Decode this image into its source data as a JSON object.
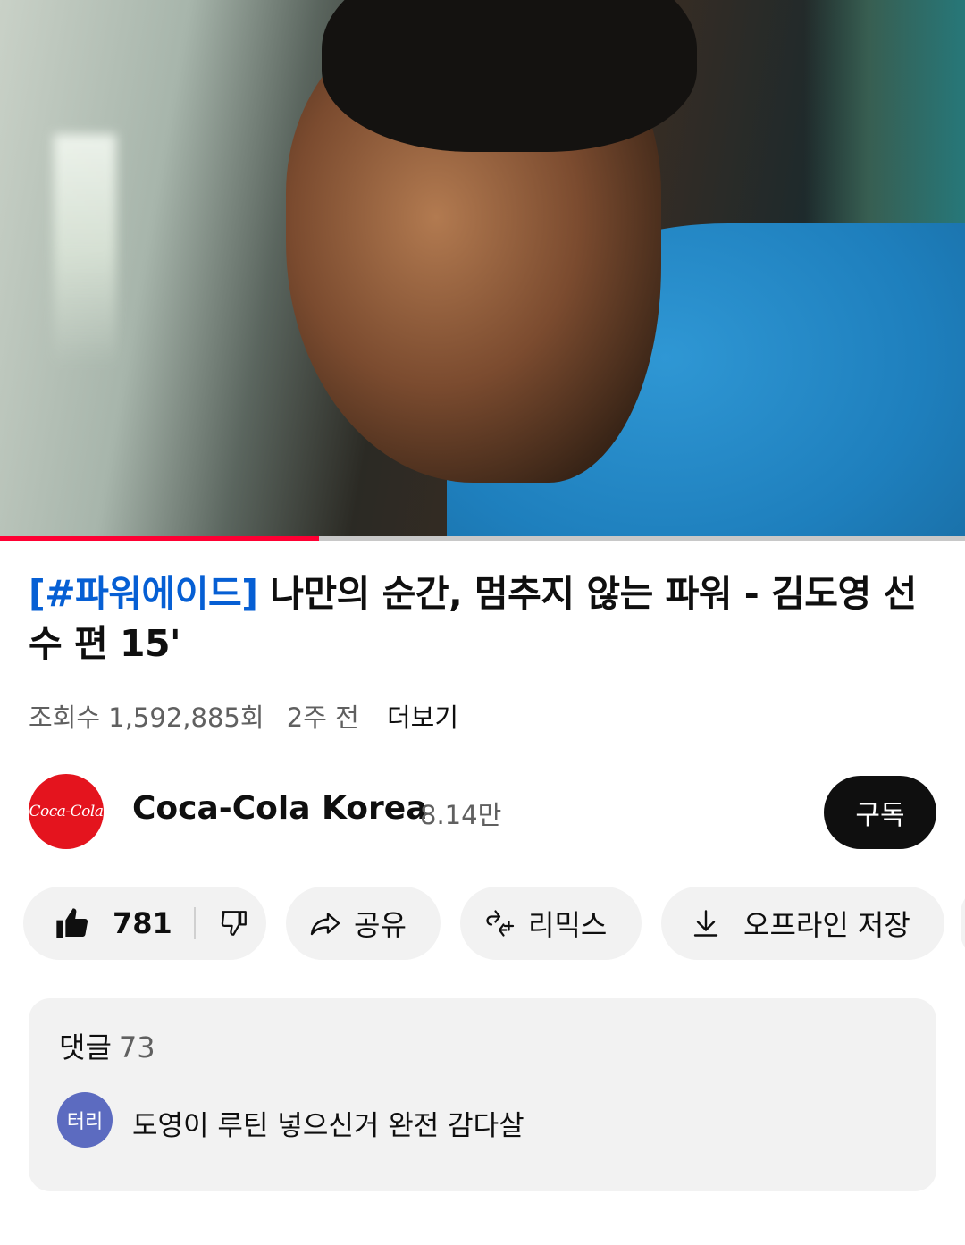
{
  "video": {
    "progress_fraction": 0.331,
    "title_tag": "[#파워에이드]",
    "title_rest": " 나만의 순간, 멈추지 않는 파워 - 김도영 선수 편 15'",
    "views": "조회수 1,592,885회",
    "age": "2주 전",
    "more_label": "더보기"
  },
  "channel": {
    "logo_text": "Coca-Cola",
    "name": "Coca-Cola Korea",
    "subscribers": "8.14만",
    "subscribe_label": "구독"
  },
  "actions": {
    "like_count": "781",
    "share_label": "공유",
    "remix_label": "리믹스",
    "download_label": "오프라인 저장"
  },
  "comments": {
    "label": "댓글",
    "count": "73",
    "top_comment": {
      "avatar_text": "터리",
      "text": "도영이 루틴 넣으신거 완전 감다살"
    }
  },
  "colors": {
    "progress": "#ff0033",
    "link_blue": "#065fd4",
    "coke_red": "#e4141e",
    "avatar": "#5c6bc0"
  },
  "icons": [
    "like-icon",
    "dislike-icon",
    "share-icon",
    "remix-icon",
    "download-icon"
  ]
}
